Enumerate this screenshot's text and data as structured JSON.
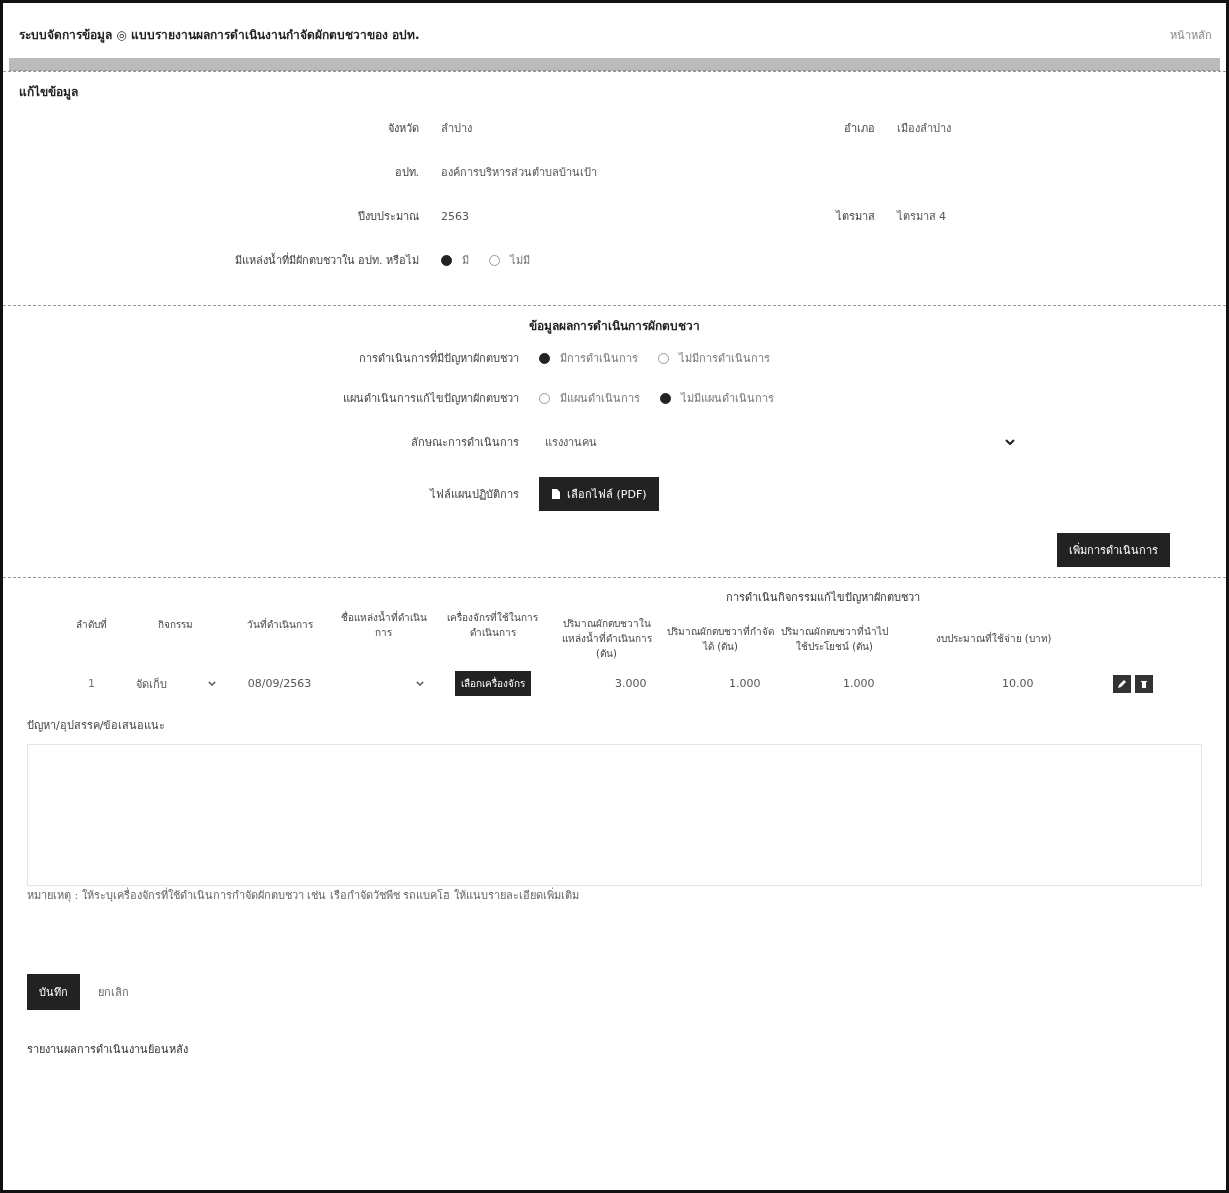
{
  "header": {
    "title": "ระบบจัดการข้อมูล ◎ แบบรายงานผลการดำเนินงานกำจัดผักตบชวาของ อปท.",
    "user": "หน้าหลัก"
  },
  "edit_section": {
    "heading": "แก้ไขข้อมูล",
    "rows": [
      [
        {
          "label": "จังหวัด",
          "value": "ลำปาง"
        },
        {
          "label": "อำเภอ",
          "value": "เมืองลำปาง"
        }
      ],
      [
        {
          "label": "อปท.",
          "value": "องค์การบริหารส่วนตำบลบ้านเป้า"
        }
      ],
      [
        {
          "label": "ปีงบประมาณ",
          "value": "2563"
        },
        {
          "label": "ไตรมาส",
          "value": "ไตรมาส 4"
        }
      ]
    ],
    "water_question": {
      "label": "มีแหล่งน้ำที่มีผักตบชวาใน อปท. หรือไม่",
      "options": [
        {
          "label": "มี",
          "selected": true
        },
        {
          "label": "ไม่มี",
          "selected": false
        }
      ]
    }
  },
  "result_section": {
    "heading": "ข้อมูลผลการดำเนินการผักตบชวา",
    "radio_groups": [
      {
        "label": "การดำเนินการที่มีปัญหาผักตบชวา",
        "options": [
          {
            "label": "มีการดำเนินการ",
            "selected": true
          },
          {
            "label": "ไม่มีการดำเนินการ",
            "selected": false
          }
        ]
      },
      {
        "label": "แผนดำเนินการแก้ไขปัญหาผักตบชวา",
        "options": [
          {
            "label": "มีแผนดำเนินการ",
            "selected": false
          },
          {
            "label": "ไม่มีแผนดำเนินการ",
            "selected": true
          }
        ]
      }
    ],
    "method_select": {
      "label": "ลักษณะการดำเนินการ",
      "value": "แรงงานคน"
    },
    "plan_file": {
      "label": "ไฟล์แผนปฏิบัติการ",
      "button": "เลือกไฟล์ (PDF)"
    },
    "add_button": "เพิ่มการดำเนินการ"
  },
  "table": {
    "group_header": "การดำเนินกิจกรรมแก้ไขปัญหาผักตบชวา",
    "columns": [
      "ลำดับที่",
      "กิจกรรม",
      "วันที่ดำเนินการ",
      "ชื่อแหล่งน้ำที่ดำเนินการ",
      "เครื่องจักรที่ใช้ในการดำเนินการ",
      "ปริมาณผักตบชวาในแหล่งน้ำที่ดำเนินการ (ตัน)",
      "ปริมาณผักตบชวาที่กำจัดได้ (ตัน)",
      "ปริมาณผักตบชวาที่นำไปใช้ประโยชน์ (ตัน)",
      "งบประมาณที่ใช้จ่าย (บาท)"
    ],
    "rows": [
      {
        "cells": [
          {
            "kind": "text",
            "value": "1"
          },
          {
            "kind": "select",
            "value": "จัดเก็บ"
          },
          {
            "kind": "date",
            "value": "08/09/2563"
          },
          {
            "kind": "select"
          },
          {
            "kind": "button",
            "value": "เลือกเครื่องจักร"
          },
          {
            "kind": "number",
            "value": "3.000"
          },
          {
            "kind": "number",
            "value": "1.000"
          },
          {
            "kind": "number",
            "value": "1.000"
          },
          {
            "kind": "number",
            "value": "10.00"
          }
        ]
      }
    ]
  },
  "notes": {
    "label": "ปัญหา/อุปสรรค/ข้อเสนอแนะ",
    "remark": "หมายเหตุ : ให้ระบุเครื่องจักรที่ใช้ดำเนินการกำจัดผักตบชวา เช่น เรือกำจัดวัชพืช รถแบคโฮ ให้แนบรายละเอียดเพิ่มเติม"
  },
  "buttons": [
    {
      "label": "บันทึก",
      "kind": "primary"
    },
    {
      "label": "ยกเลิก",
      "kind": "link"
    }
  ],
  "footer_link": "รายงานผลการดำเนินงานย้อนหลัง"
}
